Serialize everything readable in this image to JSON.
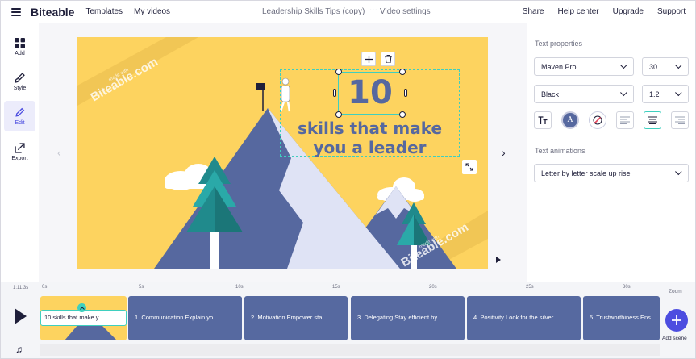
{
  "app": {
    "brand": "Biteable",
    "nav": [
      "Templates",
      "My videos"
    ],
    "doc_title": "Leadership Skills Tips (copy)",
    "doc_separator": "···",
    "video_settings": "Video settings",
    "right_nav": [
      "Share",
      "Help center",
      "Upgrade",
      "Support"
    ]
  },
  "rail": {
    "items": [
      {
        "label": "Add",
        "icon": "add-grid-icon"
      },
      {
        "label": "Style",
        "icon": "brush-icon"
      },
      {
        "label": "Edit",
        "icon": "pencil-icon",
        "active": true
      },
      {
        "label": "Export",
        "icon": "export-icon"
      }
    ]
  },
  "slide": {
    "number_text": "10",
    "line1": "skills that make",
    "line2": "you a leader",
    "watermark": "Biteable.com",
    "watermark_small": "made with",
    "colors": {
      "background": "#fdd35f",
      "text": "#56689f",
      "mountain": "#56689f",
      "snow": "#dfe3f5",
      "tree": "#208a8c"
    }
  },
  "props": {
    "title": "Text properties",
    "font": "Maven Pro",
    "size": "30",
    "color_name": "Black",
    "line_height": "1.2",
    "animations_title": "Text animations",
    "animation": "Letter by letter scale up rise",
    "colors": {
      "accent": "#3fcfbf",
      "swatch": "#56689f"
    }
  },
  "timeline": {
    "total": "1:11.3s",
    "ticks": [
      "0s",
      "5s",
      "10s",
      "15s",
      "20s",
      "25s",
      "30s"
    ],
    "scenes": [
      {
        "label": "10 skills that make y..."
      },
      {
        "label": "1. Communication Explain yo..."
      },
      {
        "label": "2. Motivation Empower sta..."
      },
      {
        "label": "3. Delegating Stay efficient by..."
      },
      {
        "label": "4. Positivity Look for the silver..."
      },
      {
        "label": "5. Trustworthiness Ens"
      }
    ],
    "zoom_label": "Zoom",
    "add_scene_label": "Add scene"
  }
}
